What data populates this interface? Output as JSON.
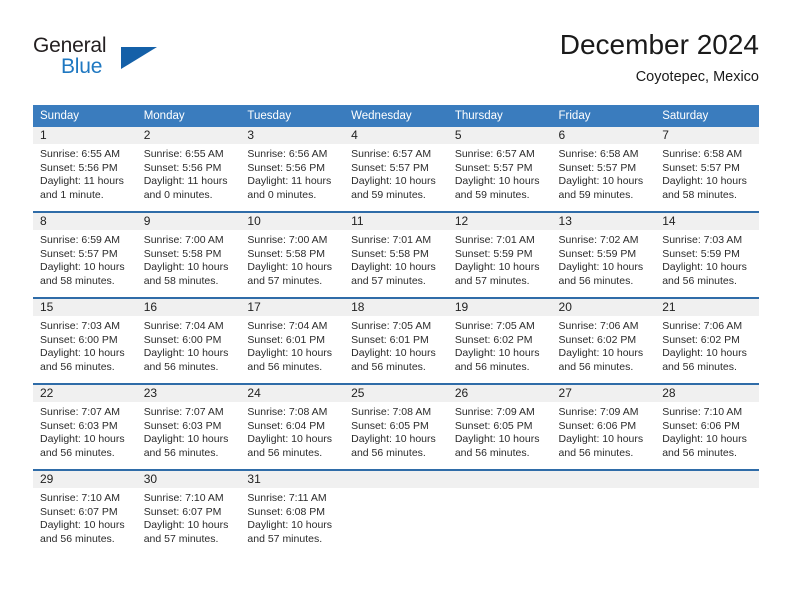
{
  "logo": {
    "word1": "General",
    "word2": "Blue",
    "triangle_color": "#1460a8",
    "blue_color": "#1f78c1"
  },
  "header": {
    "title": "December 2024",
    "subtitle": "Coyotepec, Mexico"
  },
  "theme": {
    "header_blue": "#3a7cbe",
    "row_divider_blue": "#2f6ca8",
    "daynum_band": "#f0f0f0"
  },
  "calendar": {
    "weekdays": [
      "Sunday",
      "Monday",
      "Tuesday",
      "Wednesday",
      "Thursday",
      "Friday",
      "Saturday"
    ],
    "weeks": [
      [
        {
          "day": "1",
          "sunrise": "Sunrise: 6:55 AM",
          "sunset": "Sunset: 5:56 PM",
          "daylight1": "Daylight: 11 hours",
          "daylight2": "and 1 minute."
        },
        {
          "day": "2",
          "sunrise": "Sunrise: 6:55 AM",
          "sunset": "Sunset: 5:56 PM",
          "daylight1": "Daylight: 11 hours",
          "daylight2": "and 0 minutes."
        },
        {
          "day": "3",
          "sunrise": "Sunrise: 6:56 AM",
          "sunset": "Sunset: 5:56 PM",
          "daylight1": "Daylight: 11 hours",
          "daylight2": "and 0 minutes."
        },
        {
          "day": "4",
          "sunrise": "Sunrise: 6:57 AM",
          "sunset": "Sunset: 5:57 PM",
          "daylight1": "Daylight: 10 hours",
          "daylight2": "and 59 minutes."
        },
        {
          "day": "5",
          "sunrise": "Sunrise: 6:57 AM",
          "sunset": "Sunset: 5:57 PM",
          "daylight1": "Daylight: 10 hours",
          "daylight2": "and 59 minutes."
        },
        {
          "day": "6",
          "sunrise": "Sunrise: 6:58 AM",
          "sunset": "Sunset: 5:57 PM",
          "daylight1": "Daylight: 10 hours",
          "daylight2": "and 59 minutes."
        },
        {
          "day": "7",
          "sunrise": "Sunrise: 6:58 AM",
          "sunset": "Sunset: 5:57 PM",
          "daylight1": "Daylight: 10 hours",
          "daylight2": "and 58 minutes."
        }
      ],
      [
        {
          "day": "8",
          "sunrise": "Sunrise: 6:59 AM",
          "sunset": "Sunset: 5:57 PM",
          "daylight1": "Daylight: 10 hours",
          "daylight2": "and 58 minutes."
        },
        {
          "day": "9",
          "sunrise": "Sunrise: 7:00 AM",
          "sunset": "Sunset: 5:58 PM",
          "daylight1": "Daylight: 10 hours",
          "daylight2": "and 58 minutes."
        },
        {
          "day": "10",
          "sunrise": "Sunrise: 7:00 AM",
          "sunset": "Sunset: 5:58 PM",
          "daylight1": "Daylight: 10 hours",
          "daylight2": "and 57 minutes."
        },
        {
          "day": "11",
          "sunrise": "Sunrise: 7:01 AM",
          "sunset": "Sunset: 5:58 PM",
          "daylight1": "Daylight: 10 hours",
          "daylight2": "and 57 minutes."
        },
        {
          "day": "12",
          "sunrise": "Sunrise: 7:01 AM",
          "sunset": "Sunset: 5:59 PM",
          "daylight1": "Daylight: 10 hours",
          "daylight2": "and 57 minutes."
        },
        {
          "day": "13",
          "sunrise": "Sunrise: 7:02 AM",
          "sunset": "Sunset: 5:59 PM",
          "daylight1": "Daylight: 10 hours",
          "daylight2": "and 56 minutes."
        },
        {
          "day": "14",
          "sunrise": "Sunrise: 7:03 AM",
          "sunset": "Sunset: 5:59 PM",
          "daylight1": "Daylight: 10 hours",
          "daylight2": "and 56 minutes."
        }
      ],
      [
        {
          "day": "15",
          "sunrise": "Sunrise: 7:03 AM",
          "sunset": "Sunset: 6:00 PM",
          "daylight1": "Daylight: 10 hours",
          "daylight2": "and 56 minutes."
        },
        {
          "day": "16",
          "sunrise": "Sunrise: 7:04 AM",
          "sunset": "Sunset: 6:00 PM",
          "daylight1": "Daylight: 10 hours",
          "daylight2": "and 56 minutes."
        },
        {
          "day": "17",
          "sunrise": "Sunrise: 7:04 AM",
          "sunset": "Sunset: 6:01 PM",
          "daylight1": "Daylight: 10 hours",
          "daylight2": "and 56 minutes."
        },
        {
          "day": "18",
          "sunrise": "Sunrise: 7:05 AM",
          "sunset": "Sunset: 6:01 PM",
          "daylight1": "Daylight: 10 hours",
          "daylight2": "and 56 minutes."
        },
        {
          "day": "19",
          "sunrise": "Sunrise: 7:05 AM",
          "sunset": "Sunset: 6:02 PM",
          "daylight1": "Daylight: 10 hours",
          "daylight2": "and 56 minutes."
        },
        {
          "day": "20",
          "sunrise": "Sunrise: 7:06 AM",
          "sunset": "Sunset: 6:02 PM",
          "daylight1": "Daylight: 10 hours",
          "daylight2": "and 56 minutes."
        },
        {
          "day": "21",
          "sunrise": "Sunrise: 7:06 AM",
          "sunset": "Sunset: 6:02 PM",
          "daylight1": "Daylight: 10 hours",
          "daylight2": "and 56 minutes."
        }
      ],
      [
        {
          "day": "22",
          "sunrise": "Sunrise: 7:07 AM",
          "sunset": "Sunset: 6:03 PM",
          "daylight1": "Daylight: 10 hours",
          "daylight2": "and 56 minutes."
        },
        {
          "day": "23",
          "sunrise": "Sunrise: 7:07 AM",
          "sunset": "Sunset: 6:03 PM",
          "daylight1": "Daylight: 10 hours",
          "daylight2": "and 56 minutes."
        },
        {
          "day": "24",
          "sunrise": "Sunrise: 7:08 AM",
          "sunset": "Sunset: 6:04 PM",
          "daylight1": "Daylight: 10 hours",
          "daylight2": "and 56 minutes."
        },
        {
          "day": "25",
          "sunrise": "Sunrise: 7:08 AM",
          "sunset": "Sunset: 6:05 PM",
          "daylight1": "Daylight: 10 hours",
          "daylight2": "and 56 minutes."
        },
        {
          "day": "26",
          "sunrise": "Sunrise: 7:09 AM",
          "sunset": "Sunset: 6:05 PM",
          "daylight1": "Daylight: 10 hours",
          "daylight2": "and 56 minutes."
        },
        {
          "day": "27",
          "sunrise": "Sunrise: 7:09 AM",
          "sunset": "Sunset: 6:06 PM",
          "daylight1": "Daylight: 10 hours",
          "daylight2": "and 56 minutes."
        },
        {
          "day": "28",
          "sunrise": "Sunrise: 7:10 AM",
          "sunset": "Sunset: 6:06 PM",
          "daylight1": "Daylight: 10 hours",
          "daylight2": "and 56 minutes."
        }
      ],
      [
        {
          "day": "29",
          "sunrise": "Sunrise: 7:10 AM",
          "sunset": "Sunset: 6:07 PM",
          "daylight1": "Daylight: 10 hours",
          "daylight2": "and 56 minutes."
        },
        {
          "day": "30",
          "sunrise": "Sunrise: 7:10 AM",
          "sunset": "Sunset: 6:07 PM",
          "daylight1": "Daylight: 10 hours",
          "daylight2": "and 57 minutes."
        },
        {
          "day": "31",
          "sunrise": "Sunrise: 7:11 AM",
          "sunset": "Sunset: 6:08 PM",
          "daylight1": "Daylight: 10 hours",
          "daylight2": "and 57 minutes."
        },
        {
          "day": "",
          "sunrise": "",
          "sunset": "",
          "daylight1": "",
          "daylight2": ""
        },
        {
          "day": "",
          "sunrise": "",
          "sunset": "",
          "daylight1": "",
          "daylight2": ""
        },
        {
          "day": "",
          "sunrise": "",
          "sunset": "",
          "daylight1": "",
          "daylight2": ""
        },
        {
          "day": "",
          "sunrise": "",
          "sunset": "",
          "daylight1": "",
          "daylight2": ""
        }
      ]
    ]
  }
}
